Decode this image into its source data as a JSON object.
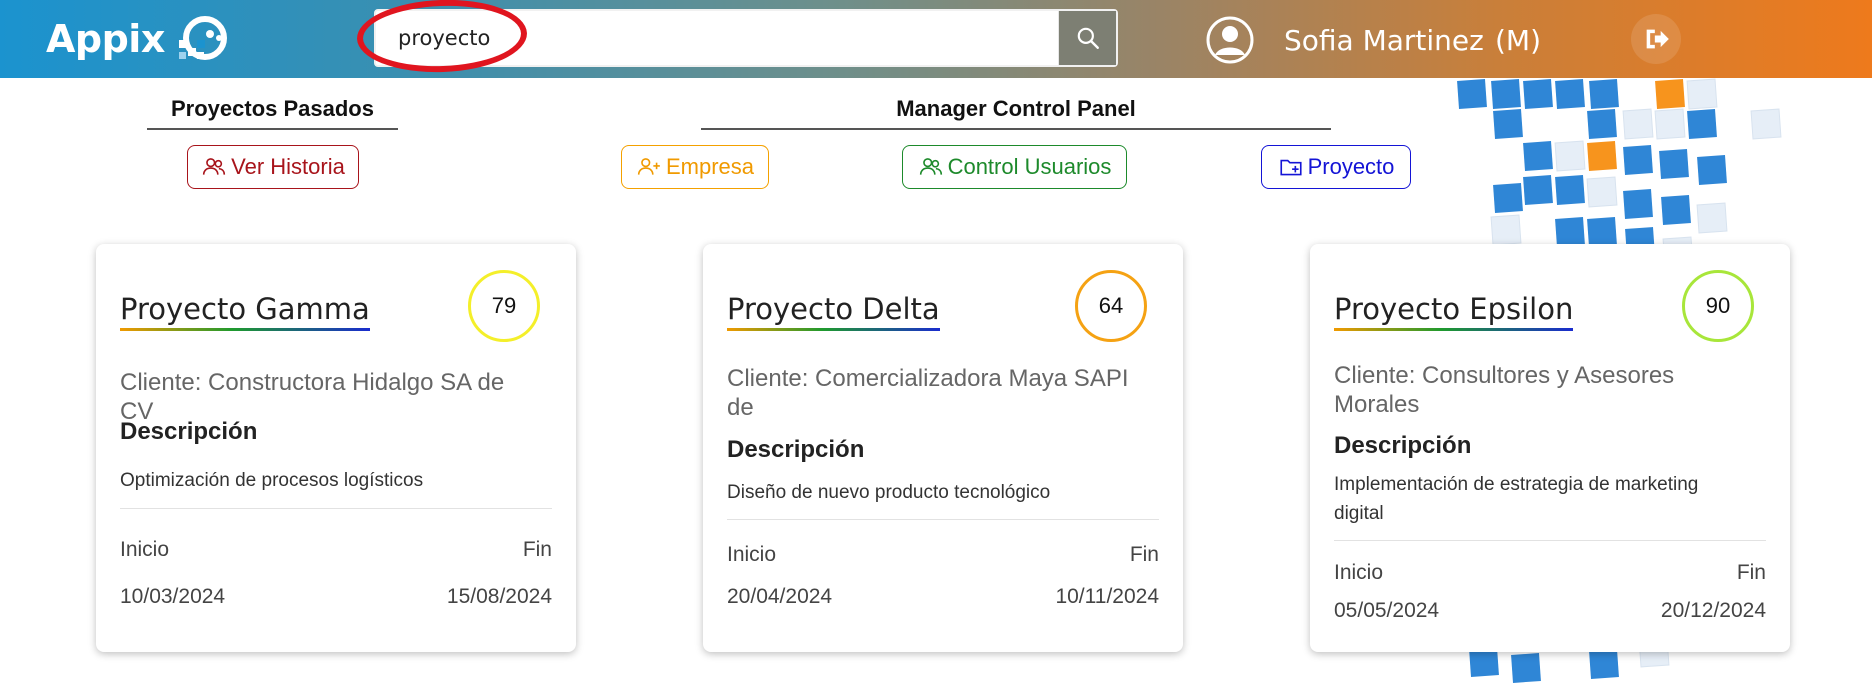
{
  "header": {
    "logo_text": "Appix",
    "search": {
      "value": "proyecto",
      "placeholder": ""
    },
    "user": {
      "name": "Sofia Martinez",
      "role": "(M)"
    },
    "icons": [
      "logo-mark-icon",
      "search-icon",
      "user-avatar-icon",
      "logout-icon"
    ]
  },
  "past": {
    "title": "Proyectos Pasados",
    "history_label": "Ver Historia"
  },
  "manager": {
    "title": "Manager Control Panel",
    "buttons": [
      {
        "label": "Empresa",
        "icon": "add-user-icon",
        "color": "#f09a00"
      },
      {
        "label": "Control Usuarios",
        "icon": "users-icon",
        "color": "#1d8a2b"
      },
      {
        "label": "Proyecto",
        "icon": "add-folder-icon",
        "color": "#1414d6"
      }
    ]
  },
  "cards": [
    {
      "title": "Proyecto Gamma",
      "score": "79",
      "score_color": "#f4ef2a",
      "client": "Cliente: Constructora Hidalgo SA de CV",
      "desc_heading": "Descripción",
      "description": "Optimización de procesos logísticos",
      "start_label": "Inicio",
      "end_label": "Fin",
      "start": "10/03/2024",
      "end": "15/08/2024"
    },
    {
      "title": "Proyecto Delta",
      "score": "64",
      "score_color": "#f5a213",
      "client": "Cliente: Comercializadora Maya SAPI de",
      "desc_heading": "Descripción",
      "description": "Diseño de nuevo producto tecnológico",
      "start_label": "Inicio",
      "end_label": "Fin",
      "start": "20/04/2024",
      "end": "10/11/2024"
    },
    {
      "title": "Proyecto Epsilon",
      "score": "90",
      "score_color": "#a8e63a",
      "client": "Cliente: Consultores y Asesores Morales",
      "desc_heading": "Descripción",
      "description": "Implementación de estrategia de marketing digital",
      "start_label": "Inicio",
      "end_label": "Fin",
      "start": "05/05/2024",
      "end": "20/12/2024"
    }
  ]
}
